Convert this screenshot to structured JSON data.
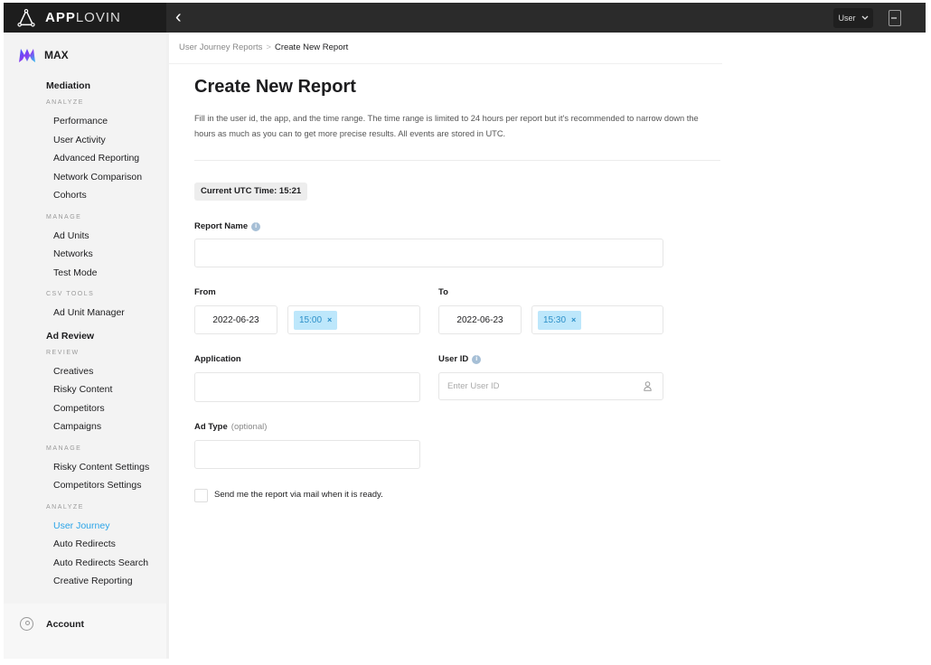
{
  "app": {
    "brand_bold": "APP",
    "brand_light": "LOVIN",
    "product": "MAX"
  },
  "topbar": {
    "back_icon": "‹",
    "user_menu_label": "User",
    "user_menu_chevron": "⌄"
  },
  "sidebar": {
    "sections": [
      {
        "title": "Mediation",
        "groups": [
          {
            "heading": "ANALYZE",
            "items": [
              "Performance",
              "User Activity",
              "Advanced Reporting",
              "Network Comparison",
              "Cohorts"
            ]
          },
          {
            "heading": "MANAGE",
            "items": [
              "Ad Units",
              "Networks",
              "Test Mode"
            ]
          },
          {
            "heading": "CSV TOOLS",
            "items": [
              "Ad Unit Manager"
            ]
          }
        ]
      },
      {
        "title": "Ad Review",
        "groups": [
          {
            "heading": "REVIEW",
            "items": [
              "Creatives",
              "Risky Content",
              "Competitors",
              "Campaigns"
            ]
          },
          {
            "heading": "MANAGE",
            "items": [
              "Risky Content Settings",
              "Competitors Settings"
            ]
          },
          {
            "heading": "ANALYZE",
            "items": [
              "User Journey",
              "Auto Redirects",
              "Auto Redirects Search",
              "Creative Reporting"
            ]
          }
        ]
      }
    ],
    "active_item": "User Journey",
    "account_label": "Account",
    "colors": {
      "active": "#2aa4e8"
    }
  },
  "breadcrumb": {
    "parent": "User Journey Reports",
    "separator": ">",
    "current": "Create New Report"
  },
  "page": {
    "title": "Create New Report",
    "description": "Fill in the user id, the app, and the time range. The time range is limited to 24 hours per report but it's recommended to narrow down the hours as much as you can to get more precise results. All events are stored in UTC.",
    "current_utc": "Current UTC Time: 15:21"
  },
  "form": {
    "report_name": {
      "label": "Report Name",
      "value": ""
    },
    "from": {
      "label": "From",
      "date": "2022-06-23",
      "time": "15:00"
    },
    "to": {
      "label": "To",
      "date": "2022-06-23",
      "time": "15:30"
    },
    "application": {
      "label": "Application",
      "value": ""
    },
    "user_id": {
      "label": "User ID",
      "placeholder": "Enter User ID",
      "value": ""
    },
    "ad_type": {
      "label": "Ad Type",
      "optional": "(optional)",
      "value": ""
    },
    "send_mail": {
      "label": "Send me the report via mail when it is ready.",
      "checked": false
    },
    "tag_remove": "×",
    "info_glyph": "i"
  }
}
